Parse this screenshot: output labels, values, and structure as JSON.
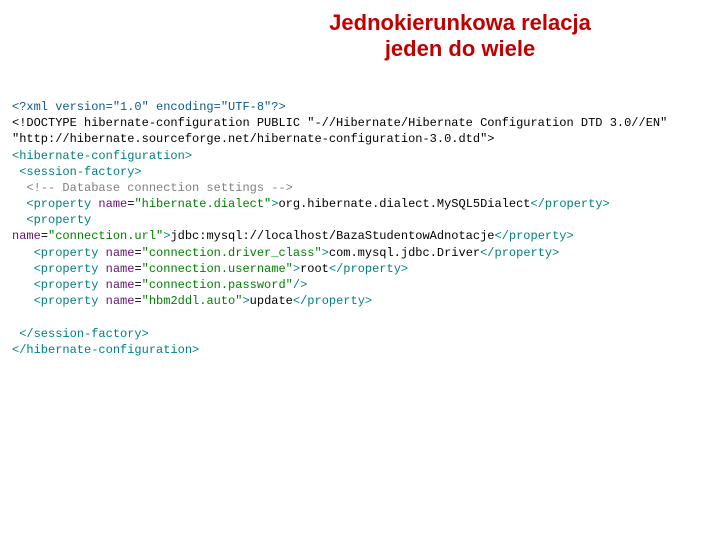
{
  "title_line1": "Jednokierunkowa relacja",
  "title_line2": "jeden do wiele",
  "l1": "<?xml version=\"1.0\" encoding=\"UTF-8\"?>",
  "l2": "<!DOCTYPE hibernate-configuration PUBLIC \"-//Hibernate/Hibernate Configuration DTD 3.0//EN\" \"http://hibernate.sourceforge.net/hibernate-configuration-3.0.dtd\">",
  "tag_hcfg_open": "<hibernate-configuration>",
  "tag_sf_open": "<session-factory>",
  "comment": "<!-- Database connection settings -->",
  "tag_prop_open": "<property",
  "tag_prop_close": "</property>",
  "attr_name": "name",
  "eq": "=",
  "gt": ">",
  "sc_gt": "/>",
  "name_dialect": "\"hibernate.dialect\"",
  "val_dialect": "org.hibernate.dialect.MySQL5Dialect",
  "name_url": "\"connection.url\"",
  "val_url": "jdbc:mysql://localhost/BazaStudentowAdnotacje",
  "name_driver": "\"connection.driver_class\"",
  "val_driver": "com.mysql.jdbc.Driver",
  "name_user": "\"connection.username\"",
  "val_user": "root",
  "name_pwd": "\"connection.password\"",
  "name_hbm": "\"hbm2ddl.auto\"",
  "val_hbm": "update",
  "tag_sf_close": "</session-factory>",
  "tag_hcfg_close": "</hibernate-configuration>"
}
